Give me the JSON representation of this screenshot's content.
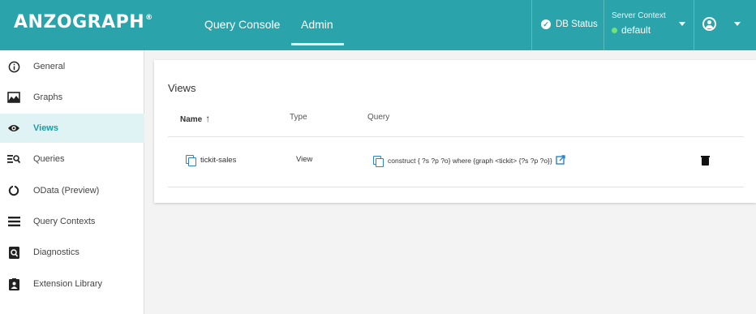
{
  "header": {
    "logo": "ANZOᶜGRAPH",
    "logo_text": "ANZOGRAPH",
    "logo_reg": "®",
    "tabs": [
      {
        "label": "Query Console"
      },
      {
        "label": "Admin"
      }
    ],
    "db_status": "DB Status",
    "server_context": {
      "title": "Server Context",
      "value": "default"
    },
    "accent": "#2aa3ab"
  },
  "sidebar": {
    "items": [
      {
        "label": "General",
        "icon": "info-icon"
      },
      {
        "label": "Graphs",
        "icon": "image-icon"
      },
      {
        "label": "Views",
        "icon": "eye-icon",
        "active": true
      },
      {
        "label": "Queries",
        "icon": "query-search-icon"
      },
      {
        "label": "OData (Preview)",
        "icon": "circle-icon"
      },
      {
        "label": "Query Contexts",
        "icon": "list-icon"
      },
      {
        "label": "Diagnostics",
        "icon": "diagnostics-icon"
      },
      {
        "label": "Extension Library",
        "icon": "library-icon"
      }
    ]
  },
  "views": {
    "title": "Views",
    "columns": {
      "name": "Name",
      "type": "Type",
      "query": "Query"
    },
    "rows": [
      {
        "name": "tickit-sales",
        "type": "View",
        "query": "construct { ?s ?p ?o} where {graph <tickit> {?s ?p ?o}}"
      }
    ]
  }
}
